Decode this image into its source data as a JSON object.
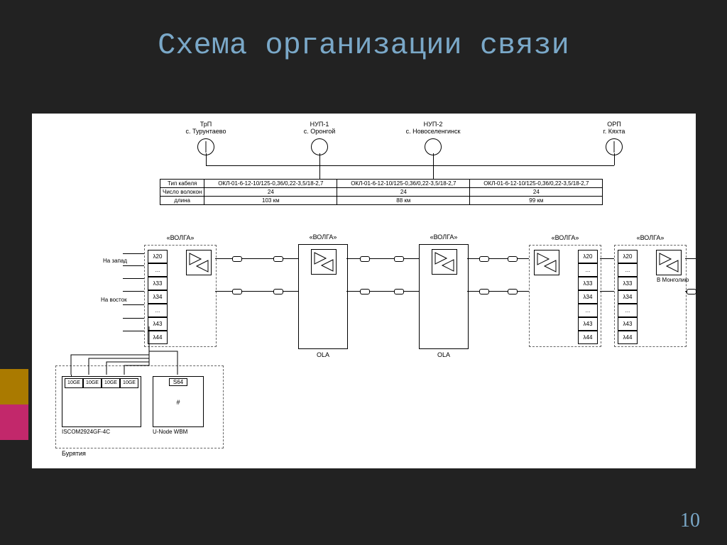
{
  "title": "Схема организации связи",
  "page": "10",
  "nodes": {
    "n1": {
      "top": "ТрП",
      "bottom": "с. Турунтаево"
    },
    "n2": {
      "top": "НУП-1",
      "bottom": "с. Оронгой"
    },
    "n3": {
      "top": "НУП-2",
      "bottom": "с. Новоселенгинск"
    },
    "n4": {
      "top": "ОРП",
      "bottom": "г. Кяхта"
    }
  },
  "table": {
    "r1": {
      "h": "Тип кабеля",
      "c1": "ОКЛ-01-6-12-10/125-0,36/0,22-3,5/18-2,7",
      "c2": "ОКЛ-01-6-12-10/125-0,36/0,22-3,5/18-2,7",
      "c3": "ОКЛ-01-6-12-10/125-0,36/0,22-3,5/18-2,7"
    },
    "r2": {
      "h": "Число волокон",
      "c1": "24",
      "c2": "24",
      "c3": "24"
    },
    "r3": {
      "h": "длина",
      "c1": "103 км",
      "c2": "88 км",
      "c3": "99 км"
    }
  },
  "system": "«ВОЛГА»",
  "channels": {
    "c0": "λ20",
    "c1": "...",
    "c2": "λ33",
    "c3": "λ34",
    "c4": "...",
    "c5": "λ43",
    "c6": "λ44"
  },
  "directions": {
    "west": "На запад",
    "east": "На восток",
    "mongolia": "В Монголию"
  },
  "ola": "OLA",
  "equip": {
    "iscom": {
      "name": "ISCOM2924GF-4C",
      "ports": "10GE"
    },
    "unode": {
      "name": "U-Node WBM",
      "s": "S64",
      "hash": "#"
    },
    "region": "Бурятия"
  }
}
